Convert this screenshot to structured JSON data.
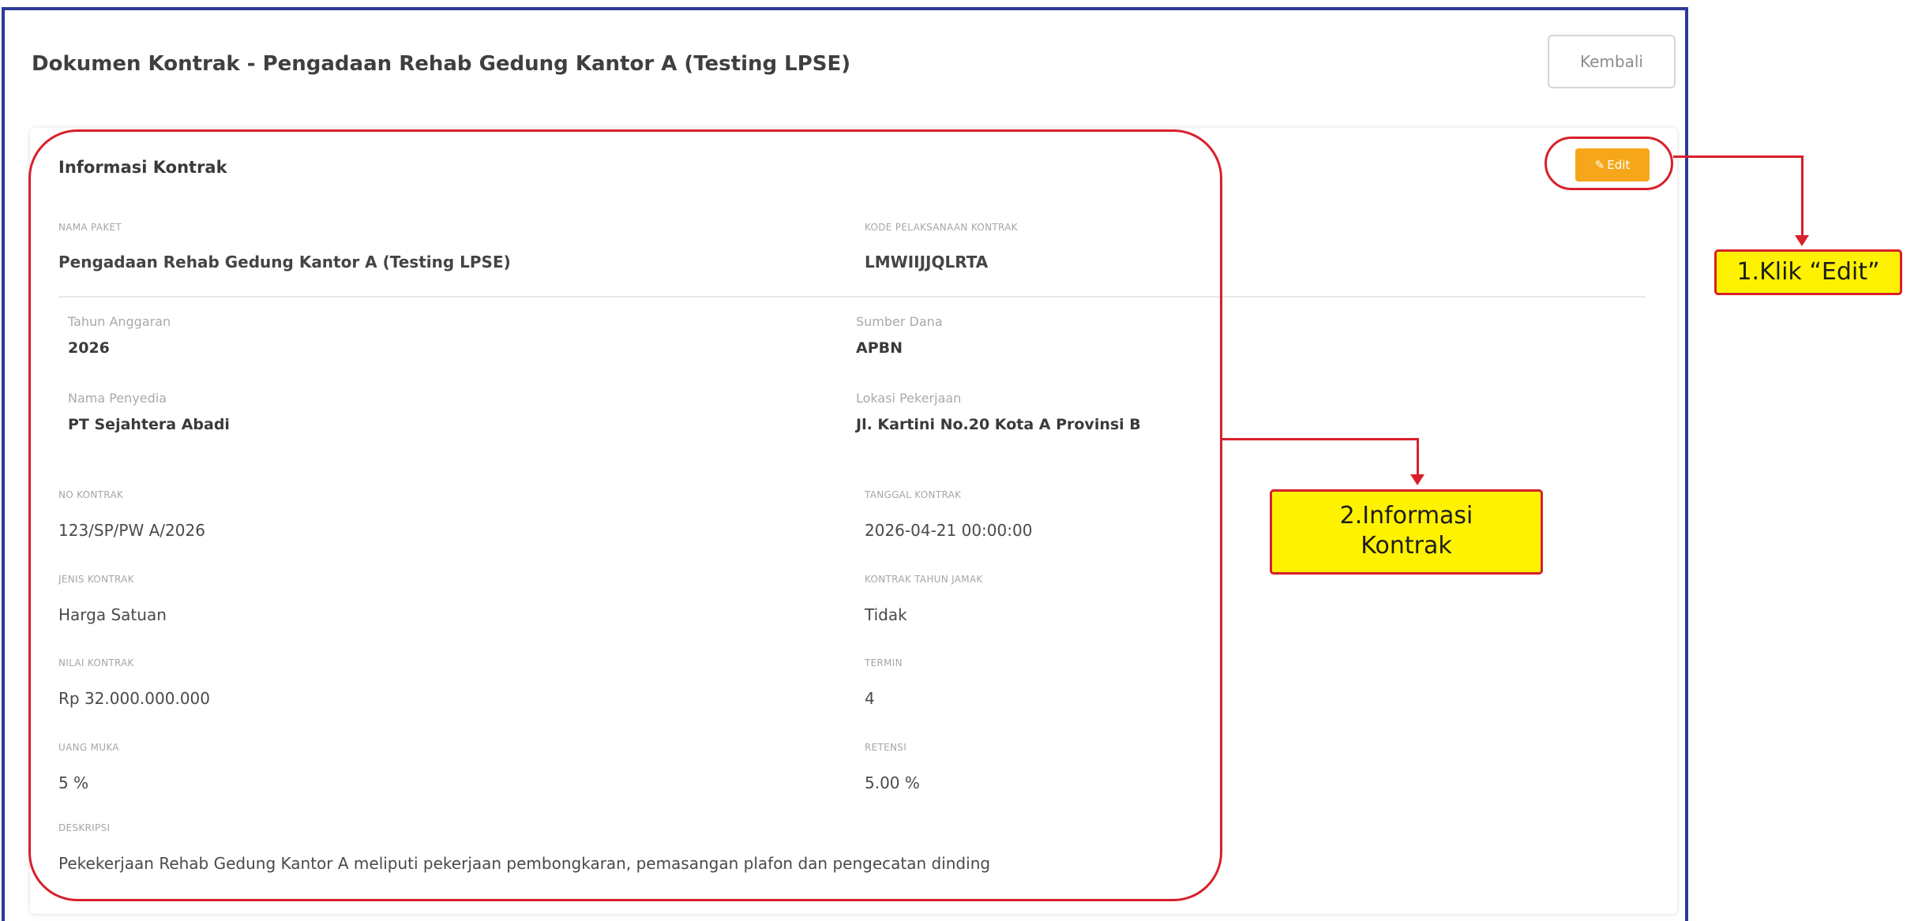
{
  "header": {
    "title": "Dokumen Kontrak - Pengadaan Rehab Gedung Kantor A (Testing LPSE)",
    "back_label": "Kembali"
  },
  "card": {
    "title": "Informasi Kontrak",
    "edit_label": "Edit",
    "edit_icon": "pencil-icon"
  },
  "fields": {
    "nama_paket": {
      "label": "NAMA PAKET",
      "value": "Pengadaan Rehab Gedung Kantor A (Testing LPSE)"
    },
    "kode_pelaksanaan": {
      "label": "KODE PELAKSANAAN KONTRAK",
      "value": "LMWIIJJQLRTA"
    },
    "tahun_anggaran": {
      "label": "Tahun Anggaran",
      "value": "2026"
    },
    "sumber_dana": {
      "label": "Sumber Dana",
      "value": "APBN"
    },
    "nama_penyedia": {
      "label": "Nama Penyedia",
      "value": "PT Sejahtera Abadi"
    },
    "lokasi_pekerjaan": {
      "label": "Lokasi Pekerjaan",
      "value": "Jl. Kartini No.20 Kota A Provinsi B"
    },
    "no_kontrak": {
      "label": "NO KONTRAK",
      "value": "123/SP/PW A/2026"
    },
    "tanggal_kontrak": {
      "label": "TANGGAL KONTRAK",
      "value": "2026-04-21 00:00:00"
    },
    "jenis_kontrak": {
      "label": "JENIS KONTRAK",
      "value": "Harga Satuan"
    },
    "kontrak_tahun_jamak": {
      "label": "KONTRAK TAHUN JAMAK",
      "value": "Tidak"
    },
    "nilai_kontrak": {
      "label": "NILAI KONTRAK",
      "value": "Rp 32.000.000.000"
    },
    "termin": {
      "label": "TERMIN",
      "value": "4"
    },
    "uang_muka": {
      "label": "UANG MUKA",
      "value": "5 %"
    },
    "retensi": {
      "label": "RETENSI",
      "value": "5.00 %"
    },
    "deskripsi": {
      "label": "DESKRIPSI",
      "value": "Pekekerjaan Rehab Gedung Kantor A meliputi pekerjaan pembongkaran, pemasangan plafon dan pengecatan dinding"
    }
  },
  "annotations": {
    "note1": "1.Klik “Edit”",
    "note2_line1": "2.Informasi",
    "note2_line2": "Kontrak",
    "color": "#d8202a",
    "note_fill": "#fff200",
    "frame_color": "#2b3a9a"
  }
}
